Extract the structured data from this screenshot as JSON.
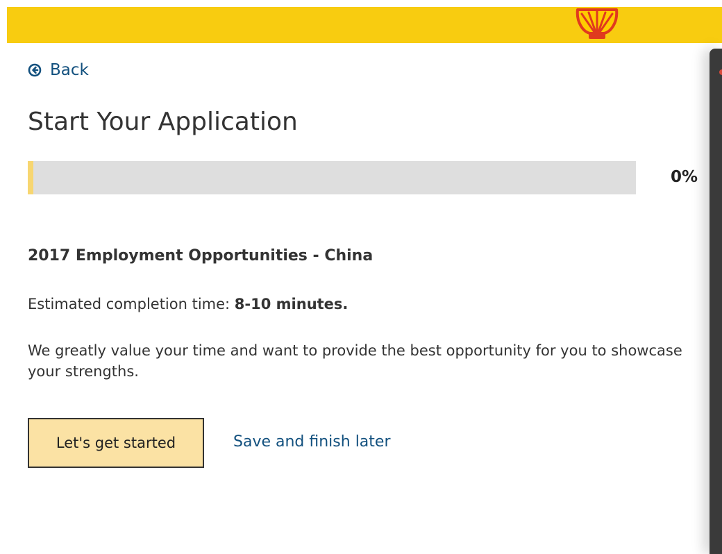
{
  "header": {
    "logo_icon": "shell-logo-icon",
    "bar_color": "#f8cc10"
  },
  "nav": {
    "back_label": "Back",
    "back_icon": "circle-arrow-left-icon"
  },
  "page": {
    "title": "Start Your Application"
  },
  "progress": {
    "percent_label": "0%",
    "value_percent": 0,
    "fill_color": "#f7d671",
    "track_color": "#dedede"
  },
  "job": {
    "title": "2017 Employment Opportunities - China"
  },
  "estimate": {
    "label": "Estimated completion time: ",
    "value": "8-10 minutes."
  },
  "description": {
    "text": "We greatly value your time and want to provide the best opportunity for you to showcase your strengths."
  },
  "actions": {
    "start_label": "Let's get started",
    "save_label": "Save and finish later",
    "start_button_color": "#fbe2a4",
    "link_color": "#12507e"
  }
}
